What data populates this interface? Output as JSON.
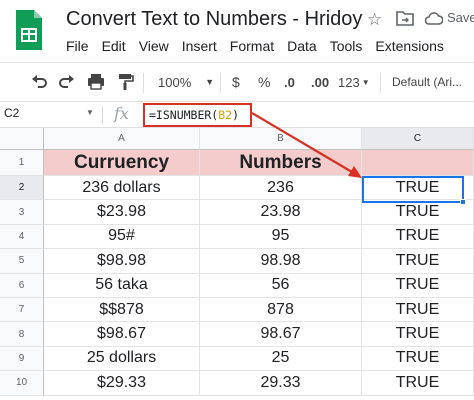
{
  "app": {
    "title": "Convert Text to Numbers - Hridoy",
    "saving_label": "Save",
    "menu": [
      "File",
      "Edit",
      "View",
      "Insert",
      "Format",
      "Data",
      "Tools",
      "Extensions"
    ]
  },
  "toolbar": {
    "zoom": "100%",
    "currency": "$",
    "percent": "%",
    "decrease_decimal": ".0",
    "increase_decimal": ".00",
    "more_formats": "123",
    "font": "Default (Ari..."
  },
  "formula_bar": {
    "cell_ref": "C2",
    "fx": "fx",
    "formula_prefix": "=ISNUMBER(",
    "formula_ref": "B2",
    "formula_suffix": ")"
  },
  "sheet": {
    "columns": [
      "A",
      "B",
      "C"
    ],
    "rows": [
      "1",
      "2",
      "3",
      "4",
      "5",
      "6",
      "7",
      "8",
      "9",
      "10"
    ],
    "header": [
      "Curruency",
      "Numbers",
      ""
    ],
    "data": [
      [
        "236 dollars",
        "236",
        "TRUE"
      ],
      [
        "$23.98",
        "23.98",
        "TRUE"
      ],
      [
        "95#",
        "95",
        "TRUE"
      ],
      [
        "$98.98",
        "98.98",
        "TRUE"
      ],
      [
        "56 taka",
        "56",
        "TRUE"
      ],
      [
        "$$878",
        "878",
        "TRUE"
      ],
      [
        "$98.67",
        "98.67",
        "TRUE"
      ],
      [
        "25 dollars",
        "25",
        "TRUE"
      ],
      [
        "$29.33",
        "29.33",
        "TRUE"
      ]
    ],
    "selected_cell": "C2"
  },
  "colors": {
    "header_fill": "#f4cccc",
    "selection": "#1a73e8",
    "annotation": "#d93025",
    "formula_ref": "#d4a200"
  }
}
